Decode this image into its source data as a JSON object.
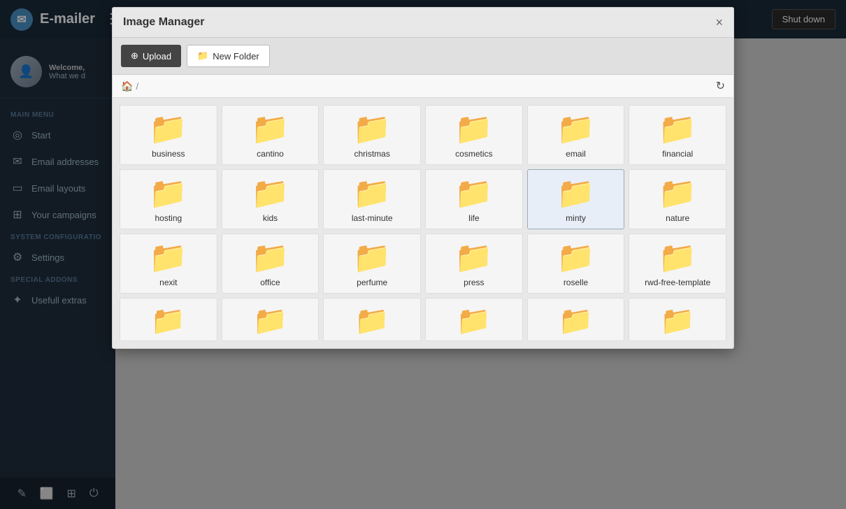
{
  "app": {
    "title": "E-mailer",
    "shutdown_label": "Shut down"
  },
  "sidebar": {
    "welcome_text": "Welcome,",
    "subtitle": "What we d",
    "section_main": "MAIN MENU",
    "section_system": "SYSTEM CONFIGURATIO",
    "section_addons": "SPECIAL ADDONS",
    "items_main": [
      {
        "label": "Start",
        "icon": "✎"
      },
      {
        "label": "Email addresses",
        "icon": "✉"
      },
      {
        "label": "Email layouts",
        "icon": "▣"
      },
      {
        "label": "Your campaigns",
        "icon": "⊞"
      }
    ],
    "items_system": [
      {
        "label": "Settings",
        "icon": "⚙"
      }
    ],
    "items_addons": [
      {
        "label": "Usefull extras",
        "icon": "⊕"
      }
    ]
  },
  "modal": {
    "title": "Image Manager",
    "upload_label": "Upload",
    "new_folder_label": "New Folder",
    "close_label": "×",
    "path": "/",
    "folders": [
      "business",
      "cantino",
      "christmas",
      "cosmetics",
      "email",
      "financial",
      "hosting",
      "kids",
      "last-minute",
      "life",
      "minty",
      "nature",
      "nexit",
      "office",
      "perfume",
      "press",
      "roselle",
      "rwd-free-template",
      "",
      "",
      "",
      "",
      "",
      ""
    ]
  }
}
